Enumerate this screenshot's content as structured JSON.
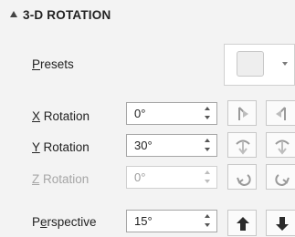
{
  "section": {
    "title": "3-D ROTATION"
  },
  "presets": {
    "label_prefix": "",
    "label_accel": "P",
    "label_rest": "resets"
  },
  "rows": [
    {
      "label_prefix": "",
      "label_accel": "X",
      "label_rest": " Rotation",
      "value": "0°",
      "enabled": true
    },
    {
      "label_prefix": "",
      "label_accel": "Y",
      "label_rest": " Rotation",
      "value": "30°",
      "enabled": true
    },
    {
      "label_prefix": "",
      "label_accel": "Z",
      "label_rest": " Rotation",
      "value": "0°",
      "enabled": false
    },
    {
      "label_prefix": "P",
      "label_accel": "e",
      "label_rest": "rspective",
      "value": "15°",
      "enabled": true
    }
  ],
  "icons": {
    "x_left": "rotate-left-icon",
    "x_right": "rotate-right-icon",
    "y_up": "rotate-up-icon",
    "y_down": "rotate-down-icon",
    "z_ccw": "rotate-counterclockwise-icon",
    "z_cw": "rotate-clockwise-icon",
    "p_increase": "arrow-up-icon",
    "p_decrease": "arrow-down-icon"
  }
}
